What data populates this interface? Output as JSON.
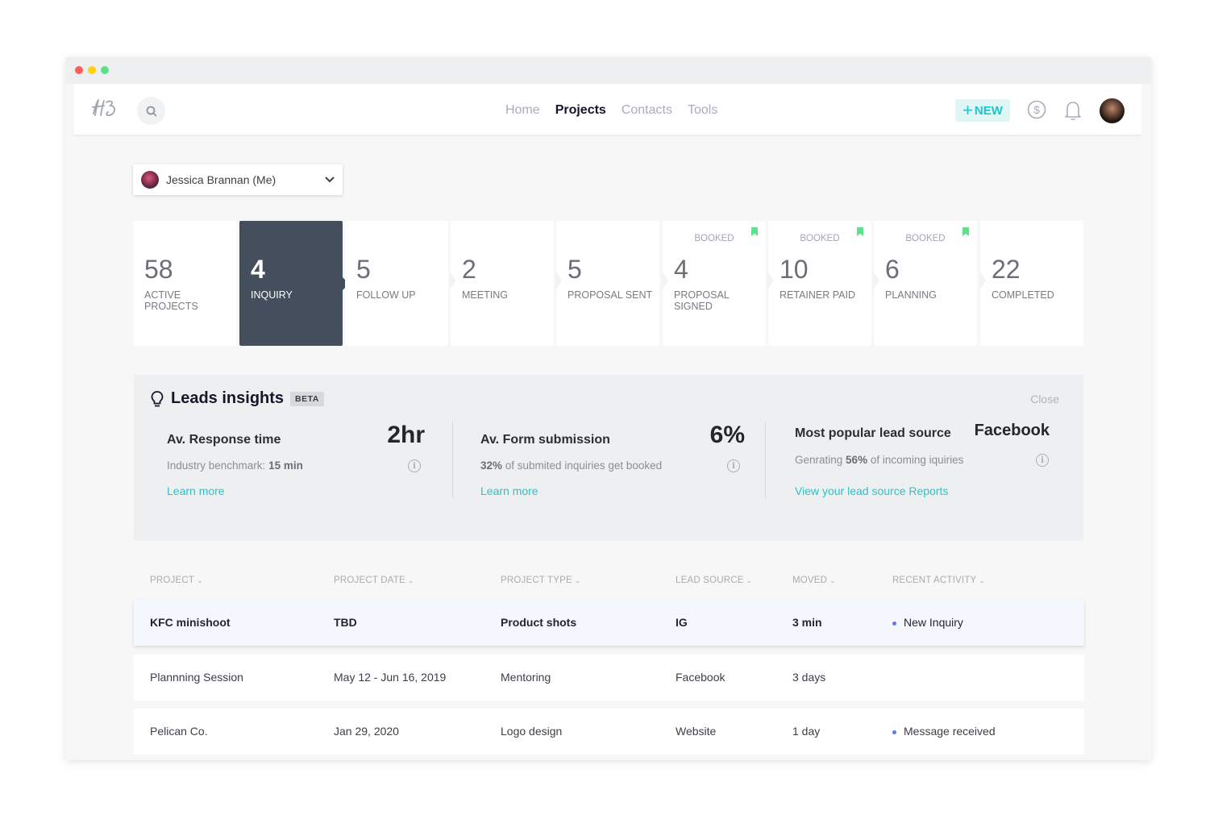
{
  "window": {
    "controls": {
      "close_color": "#ff5f57",
      "minimize_color": "#ffd30f",
      "maximize_color": "#5fde8a"
    }
  },
  "nav": {
    "logo": "HB",
    "links": [
      {
        "label": "Home",
        "active": false
      },
      {
        "label": "Projects",
        "active": true
      },
      {
        "label": "Contacts",
        "active": false
      },
      {
        "label": "Tools",
        "active": false
      }
    ],
    "new_label": "NEW",
    "icons": {
      "search": "search-icon",
      "payments": "dollar-icon",
      "notifications": "bell-icon",
      "profile": "avatar"
    }
  },
  "user_select": {
    "value": "Jessica Brannan (Me)"
  },
  "pipeline": [
    {
      "count": "58",
      "label": "ACTIVE PROJECTS",
      "booked": "",
      "active": false
    },
    {
      "count": "4",
      "label": "INQUIRY",
      "booked": "",
      "active": true
    },
    {
      "count": "5",
      "label": "FOLLOW UP",
      "booked": "",
      "active": false
    },
    {
      "count": "2",
      "label": "MEETING",
      "booked": "",
      "active": false
    },
    {
      "count": "5",
      "label": "PROPOSAL SENT",
      "booked": "",
      "active": false
    },
    {
      "count": "4",
      "label": "PROPOSAL SIGNED",
      "booked": "BOOKED",
      "active": false
    },
    {
      "count": "10",
      "label": "RETAINER PAID",
      "booked": "BOOKED",
      "active": false
    },
    {
      "count": "6",
      "label": "PLANNING",
      "booked": "BOOKED",
      "active": false
    },
    {
      "count": "22",
      "label": "COMPLETED",
      "booked": "",
      "active": false
    }
  ],
  "insights": {
    "title": "Leads insights",
    "badge": "BETA",
    "close_label": "Close",
    "metrics": [
      {
        "heading": "Av. Response time",
        "value": "2hr",
        "sub_prefix": "Industry benchmark: ",
        "sub_bold": "15 min",
        "sub_suffix": "",
        "link": "Learn more"
      },
      {
        "heading": "Av. Form submission",
        "value": "6%",
        "sub_prefix": "",
        "sub_bold": "32%",
        "sub_suffix": " of submited inquiries get booked",
        "link": "Learn more"
      },
      {
        "heading": "Most popular lead source",
        "value": "Facebook",
        "sub_prefix": "Genrating ",
        "sub_bold": "56%",
        "sub_suffix": " of incoming iquiries",
        "link": "View your lead source Reports"
      }
    ]
  },
  "table": {
    "columns": [
      "PROJECT",
      "PROJECT DATE",
      "PROJECT TYPE",
      "LEAD SOURCE",
      "MOVED",
      "RECENT ACTIVITY"
    ],
    "rows": [
      {
        "project": "KFC minishoot",
        "date": "TBD",
        "type": "Product shots",
        "source": "IG",
        "moved": "3 min",
        "activity": "New Inquiry",
        "highlighted": true
      },
      {
        "project": "Plannning Session",
        "date": "May 12 - Jun 16, 2019",
        "type": "Mentoring",
        "source": "Facebook",
        "moved": "3 days",
        "activity": "",
        "highlighted": false
      },
      {
        "project": "Pelican Co.",
        "date": "Jan 29, 2020",
        "type": "Logo design",
        "source": "Website",
        "moved": "1 day",
        "activity": "Message received",
        "highlighted": false
      }
    ]
  },
  "colors": {
    "accent": "#21c3c8",
    "active_stage": "#454e5c",
    "bookmark": "#5ee08e",
    "activity_dot": "#5b7cf0"
  }
}
